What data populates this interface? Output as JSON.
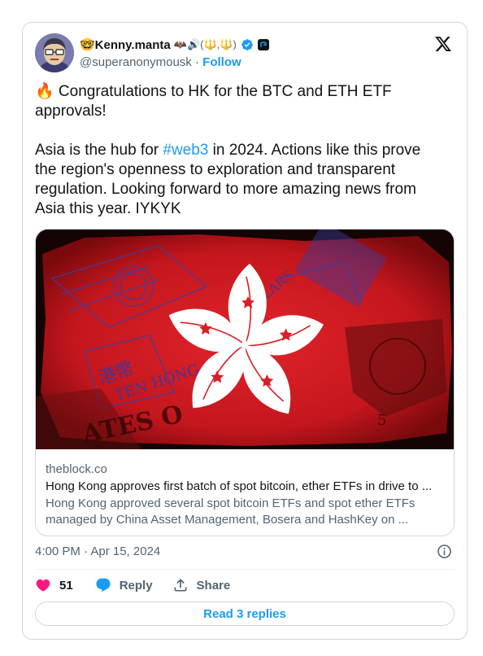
{
  "author": {
    "display_name": "🤓Kenny.manta",
    "name_decoration": "🦇🔊(🔱,🔱)",
    "handle": "@superanonymousk",
    "separator": "·",
    "follow_label": "Follow"
  },
  "tweet": {
    "line1": "🔥 Congratulations to HK for the BTC and ETH ETF approvals!",
    "para2_before": "Asia is the hub for ",
    "hashtag": "#web3",
    "para2_after": " in 2024. Actions like this prove the region's openness to exploration and transparent regulation. Looking forward to more amazing news from Asia this year. IYKYK"
  },
  "link_card": {
    "domain": "theblock.co",
    "title": "Hong Kong approves first batch of spot bitcoin, ether ETFs in drive to ...",
    "description": "Hong Kong approved several spot bitcoin ETFs and spot ether ETFs managed by China Asset Management, Bosera and HashKey on ...",
    "image_text": {
      "chinese": "港幣",
      "ten_hong": "TEN HONG",
      "dollars": "DOLLARS",
      "states": "ATES O",
      "five": "5"
    }
  },
  "timestamp": "4:00 PM · Apr 15, 2024",
  "actions": {
    "like_count": "51",
    "reply_label": "Reply",
    "share_label": "Share"
  },
  "read_replies_label": "Read 3 replies",
  "colors": {
    "accent": "#1d9bf0",
    "like": "#f91880",
    "text": "#0f1419",
    "muted": "#536471"
  }
}
